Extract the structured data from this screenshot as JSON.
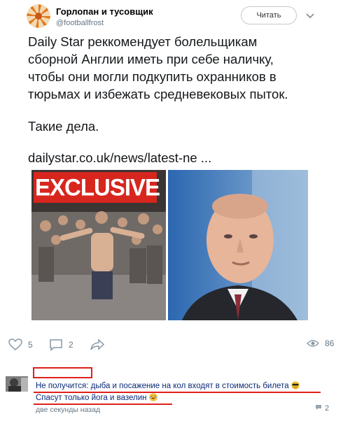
{
  "author": {
    "name": "Горлопан и тусовщик",
    "handle": "@footballfrost"
  },
  "header": {
    "read_label": "Читать"
  },
  "tweet": {
    "lines": [
      "Daily Star реккомендует болельщикам",
      "сборной Англии иметь при себе наличку,",
      "чтобы они могли подкупить охранников в",
      "тюрьмах и избежать средневековых пыток."
    ],
    "line2": "Такие дела.",
    "link": "dailystar.co.uk/news/latest-ne    ..."
  },
  "media": {
    "badge": "EXCLUSIVE"
  },
  "actions": {
    "likes": "5",
    "comments": "2",
    "views": "86"
  },
  "comment": {
    "line1": "Не получится: дыба и посажение на кол входят в стоимость билета",
    "line2": "Спасут только йога и вазелин",
    "time": "две секунды назад",
    "replies": "2"
  },
  "colors": {
    "annotation_red": "#e0201c",
    "comment_text": "#0b2a78",
    "muted": "#657786"
  }
}
